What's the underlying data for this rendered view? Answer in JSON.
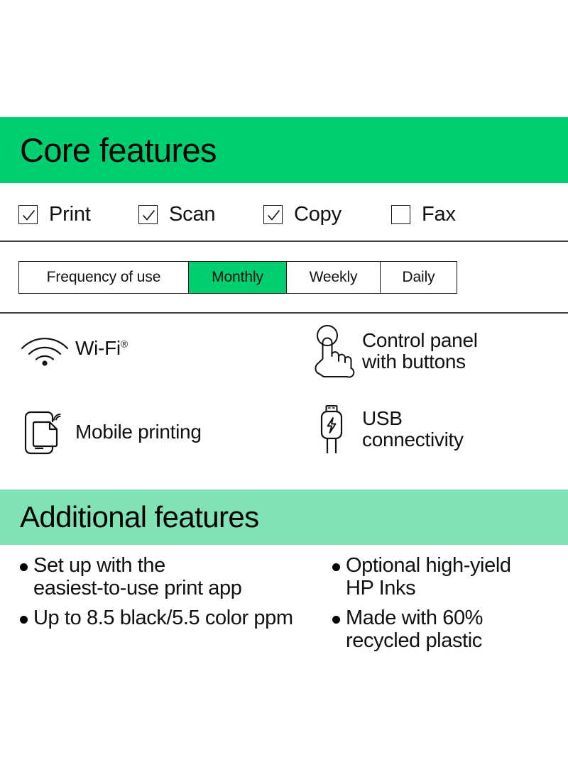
{
  "core_section": {
    "title": "Core features",
    "band_color": "#00ce70",
    "checkboxes": [
      {
        "label": "Print",
        "checked": true
      },
      {
        "label": "Scan",
        "checked": true
      },
      {
        "label": "Copy",
        "checked": true
      },
      {
        "label": "Fax",
        "checked": false
      }
    ]
  },
  "frequency": {
    "row_label": "Frequency of use",
    "options": [
      {
        "label": "Monthly",
        "selected": true
      },
      {
        "label": "Weekly",
        "selected": false
      },
      {
        "label": "Daily",
        "selected": false
      }
    ],
    "selected_color": "#00ce70"
  },
  "icon_features": [
    {
      "icon": "wifi-icon",
      "label": "Wi-Fi",
      "superscript": "®"
    },
    {
      "icon": "control-panel-hand-icon",
      "label": "Control panel\nwith buttons",
      "superscript": ""
    },
    {
      "icon": "mobile-printing-icon",
      "label": "Mobile printing",
      "superscript": ""
    },
    {
      "icon": "usb-cable-icon",
      "label": "USB\nconnectivity",
      "superscript": ""
    }
  ],
  "additional_section": {
    "title": "Additional features",
    "band_color": "#81e3b4",
    "bullets": [
      "Set up with the\neasiest-to-use print app",
      "Up to 8.5 black/5.5 color ppm",
      "Optional high-yield\nHP Inks",
      "Made with 60%\nrecycled plastic"
    ]
  }
}
